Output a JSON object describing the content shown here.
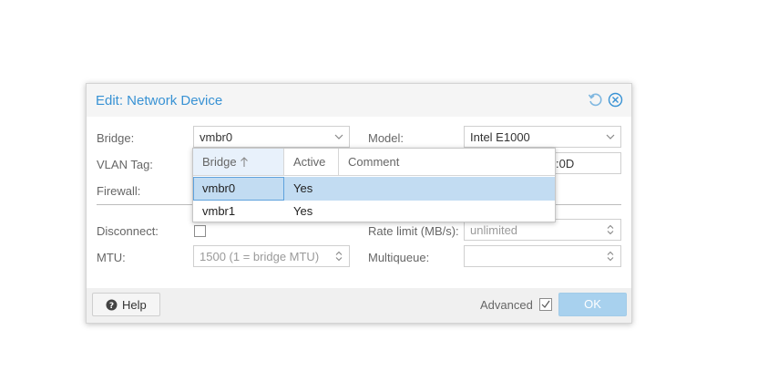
{
  "dialog": {
    "title": "Edit: Network Device",
    "tools": [
      "reset-icon",
      "close-icon"
    ]
  },
  "form": {
    "bridge": {
      "label": "Bridge:",
      "value": "vmbr0"
    },
    "vlan_tag": {
      "label": "VLAN Tag:"
    },
    "firewall": {
      "label": "Firewall:"
    },
    "model": {
      "label": "Model:",
      "value": "Intel E1000"
    },
    "mac_partial": ":0D",
    "disconnect": {
      "label": "Disconnect:",
      "checked": false
    },
    "rate_limit": {
      "label": "Rate limit (MB/s):",
      "placeholder": "unlimited"
    },
    "mtu": {
      "label": "MTU:",
      "placeholder": "1500 (1 = bridge MTU)"
    },
    "multiqueue": {
      "label": "Multiqueue:",
      "value": ""
    }
  },
  "picker": {
    "columns": [
      "Bridge",
      "Active",
      "Comment"
    ],
    "sorted_column": "Bridge",
    "rows": [
      {
        "bridge": "vmbr0",
        "active": "Yes",
        "comment": "",
        "selected": true
      },
      {
        "bridge": "vmbr1",
        "active": "Yes",
        "comment": "",
        "selected": false
      }
    ]
  },
  "footer": {
    "help_label": "Help",
    "advanced_label": "Advanced",
    "advanced_checked": true,
    "ok_label": "OK"
  },
  "colors": {
    "accent": "#3892d4",
    "selected_row": "#c2dcf2",
    "ok_disabled": "#a8d1ee"
  }
}
